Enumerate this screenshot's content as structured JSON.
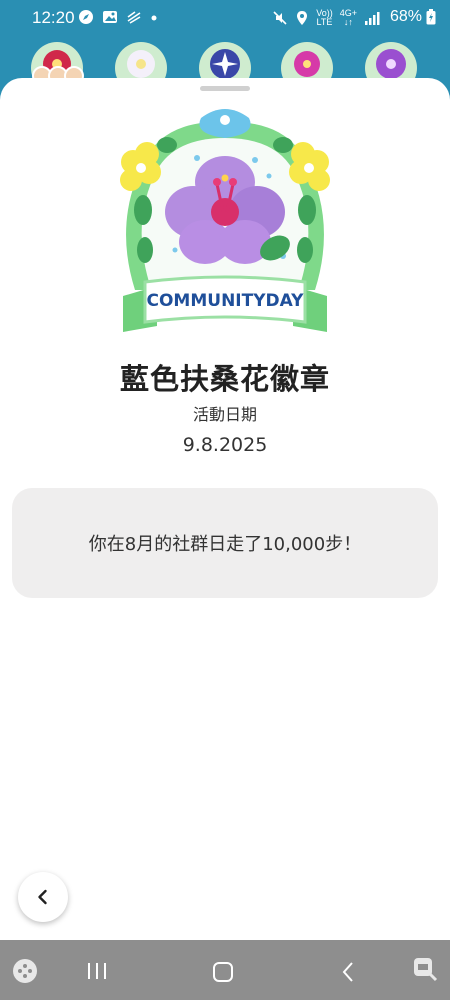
{
  "status_bar": {
    "time": "12:20",
    "battery": "68%",
    "network_top": "4G+",
    "volte_top": "Vo))",
    "volte_bottom": "LTE"
  },
  "badge": {
    "title": "藍色扶桑花徽章",
    "date_label": "活動日期",
    "date": "9.8.2025",
    "ribbon_text": "COMMUNITYDAY"
  },
  "message": "你在8月的社群日走了10,000步！",
  "colors": {
    "background_teal": "#2a8fb3",
    "sheet": "#ffffff",
    "card": "#efeeee",
    "nav_bar": "#8e8e8e",
    "ribbon_blue": "#1f4f9a",
    "flower_purple": "#b48de0"
  },
  "icons": {
    "back": "chevron-left-icon",
    "nav_recents": "recents-icon",
    "nav_home": "home-icon",
    "nav_back": "back-icon",
    "nav_game": "game-launcher-icon",
    "nav_keyboard": "keyboard-switch-icon"
  }
}
